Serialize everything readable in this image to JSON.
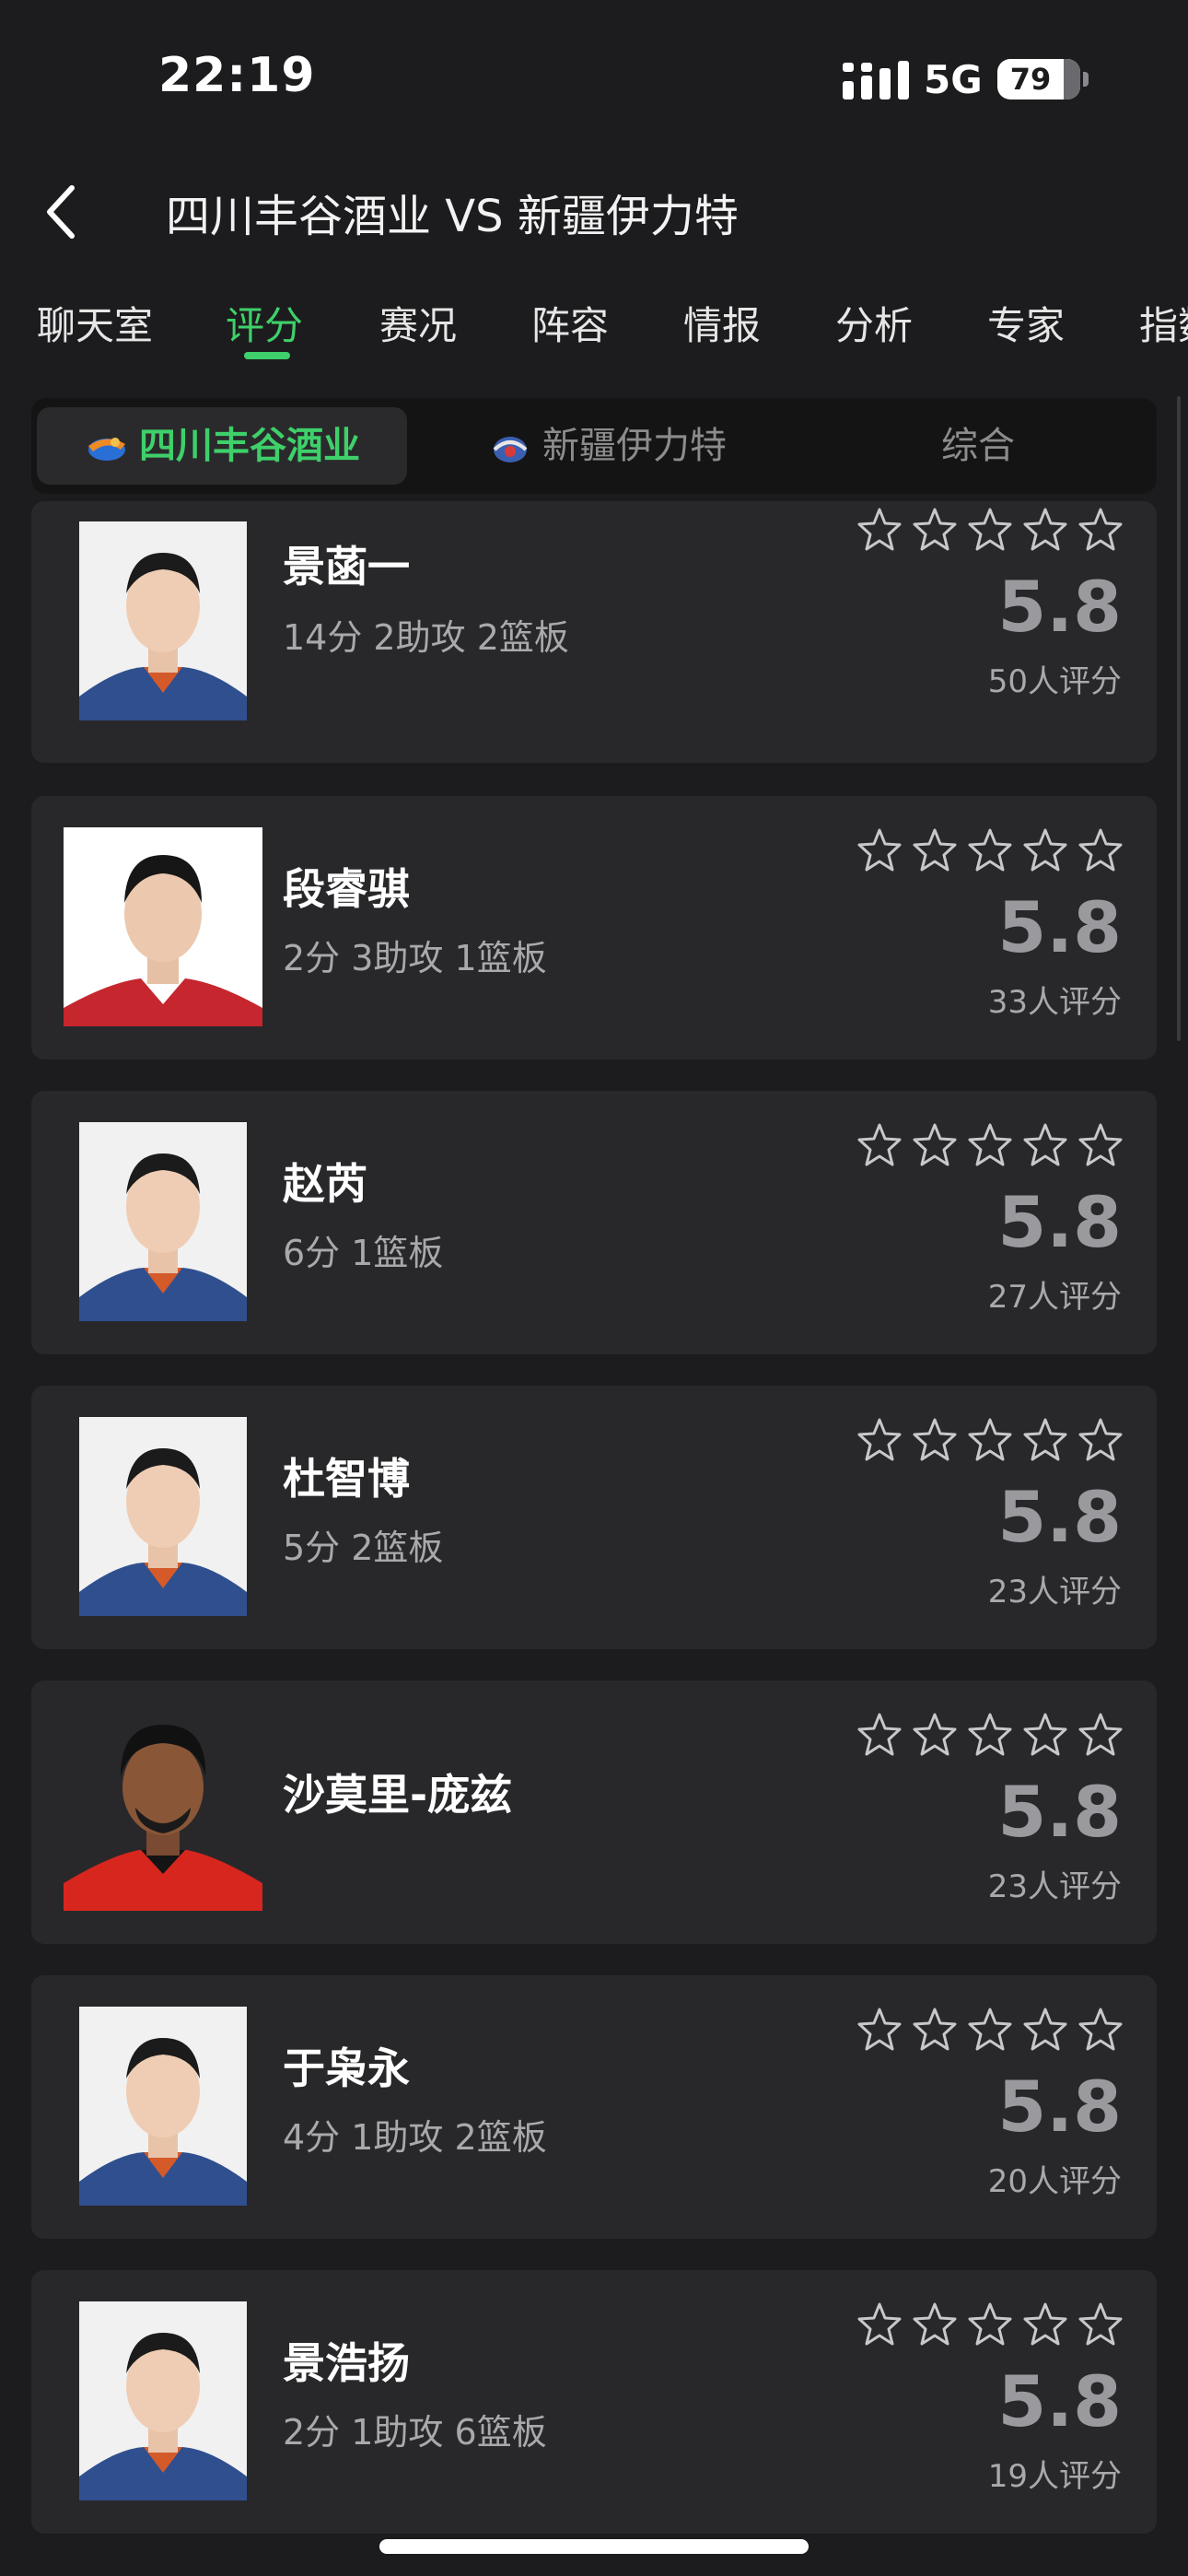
{
  "status": {
    "time": "22:19",
    "network": "5G",
    "battery": "79"
  },
  "header": {
    "title": "四川丰谷酒业 VS 新疆伊力特"
  },
  "tabs": [
    {
      "label": "聊天室",
      "active": false
    },
    {
      "label": "评分",
      "active": true
    },
    {
      "label": "赛况",
      "active": false
    },
    {
      "label": "阵容",
      "active": false
    },
    {
      "label": "情报",
      "active": false
    },
    {
      "label": "分析",
      "active": false
    },
    {
      "label": "专家",
      "active": false
    },
    {
      "label": "指数",
      "active": false
    }
  ],
  "segment": {
    "items": [
      {
        "label": "四川丰谷酒业",
        "active": true
      },
      {
        "label": "新疆伊力特",
        "active": false
      },
      {
        "label": "综合",
        "active": false
      }
    ]
  },
  "players": [
    {
      "name": "景菡一",
      "stats": "14分 2助攻 2篮板",
      "score": "5.8",
      "raters": "50人评分",
      "stars": 5
    },
    {
      "name": "段睿骐",
      "stats": "2分 3助攻 1篮板",
      "score": "5.8",
      "raters": "33人评分",
      "stars": 5
    },
    {
      "name": "赵芮",
      "stats": "6分 1篮板",
      "score": "5.8",
      "raters": "27人评分",
      "stars": 5
    },
    {
      "name": "杜智博",
      "stats": "5分 2篮板",
      "score": "5.8",
      "raters": "23人评分",
      "stars": 5
    },
    {
      "name": "沙莫里-庞兹",
      "stats": "",
      "score": "5.8",
      "raters": "23人评分",
      "stars": 5
    },
    {
      "name": "于枭永",
      "stats": "4分 1助攻 2篮板",
      "score": "5.8",
      "raters": "20人评分",
      "stars": 5
    },
    {
      "name": "景浩扬",
      "stats": "2分 1助攻 6篮板",
      "score": "5.8",
      "raters": "19人评分",
      "stars": 5
    }
  ],
  "colors": {
    "accent": "#3ed06a",
    "card": "#28282a",
    "background": "#1c1c1e"
  },
  "icons": {
    "back": "chevron-left-icon",
    "star": "star-outline-icon",
    "signal": "signal-icon",
    "battery": "battery-icon"
  }
}
